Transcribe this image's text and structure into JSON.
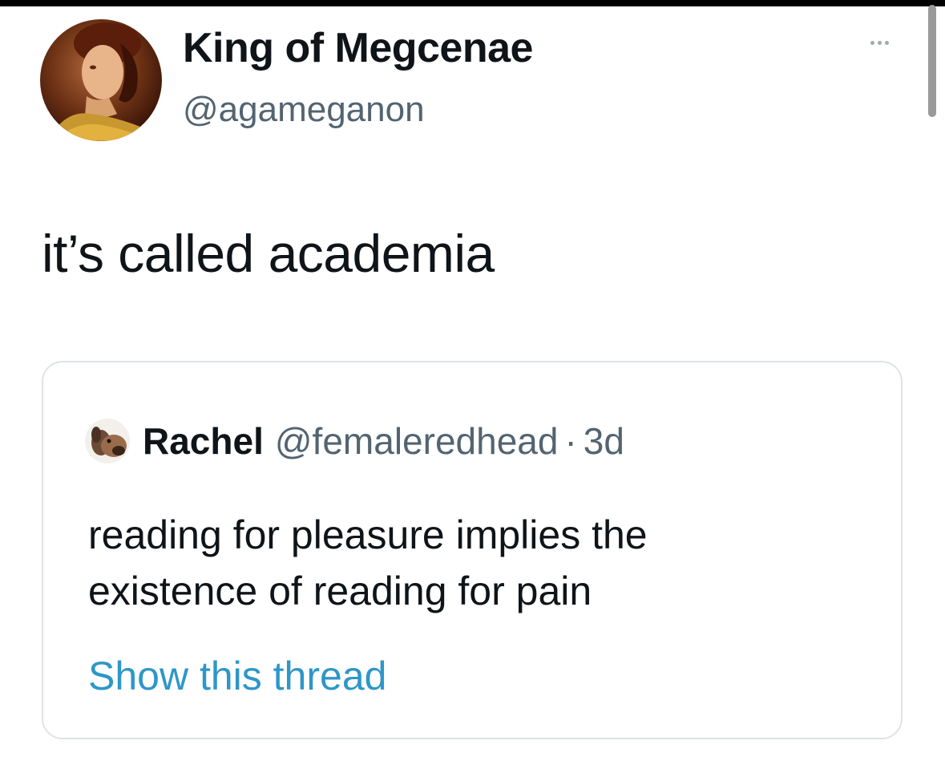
{
  "tweet": {
    "author": {
      "display_name": "King of Megcenae",
      "handle": "@agameganon",
      "avatar_icon": "portrait-avatar"
    },
    "more_icon": "more-dots-icon",
    "text": "it’s called academia"
  },
  "quoted_tweet": {
    "author": {
      "display_name": "Rachel",
      "handle": "@femaleredhead",
      "avatar_icon": "dog-avatar"
    },
    "separator": "·",
    "time": "3d",
    "text_lines": [
      "reading for pleasure implies the",
      "existence of reading for pain"
    ],
    "show_thread_label": "Show this thread"
  },
  "colors": {
    "name": "#0f1419",
    "secondary": "#536471",
    "link": "#2e96c9",
    "card_border": "#dfe3e7"
  }
}
